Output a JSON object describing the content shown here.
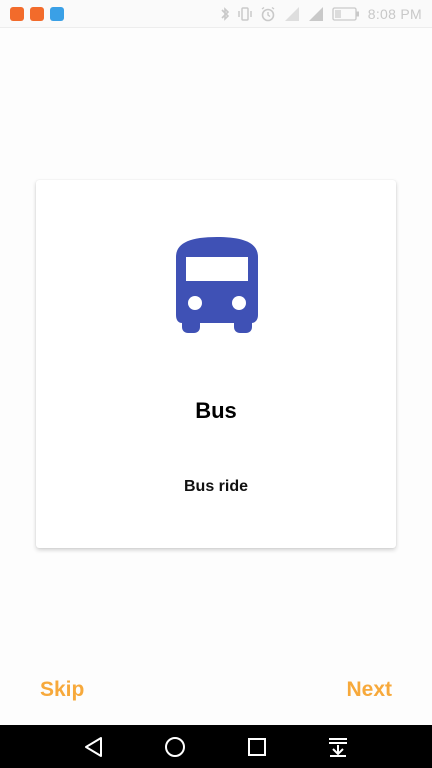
{
  "status_bar": {
    "time": "8:08 PM",
    "battery": "22",
    "notification_colors": [
      "#f26b2b",
      "#f26b2b",
      "#3aa0e6"
    ]
  },
  "card": {
    "icon": "bus-icon",
    "icon_color": "#3f51b5",
    "title": "Bus",
    "subtitle": "Bus ride"
  },
  "actions": {
    "skip_label": "Skip",
    "next_label": "Next",
    "accent_color": "#f7a93b"
  },
  "nav_bar": {
    "buttons": [
      "back-icon",
      "home-icon",
      "recents-icon",
      "notifications-pull-icon"
    ]
  }
}
